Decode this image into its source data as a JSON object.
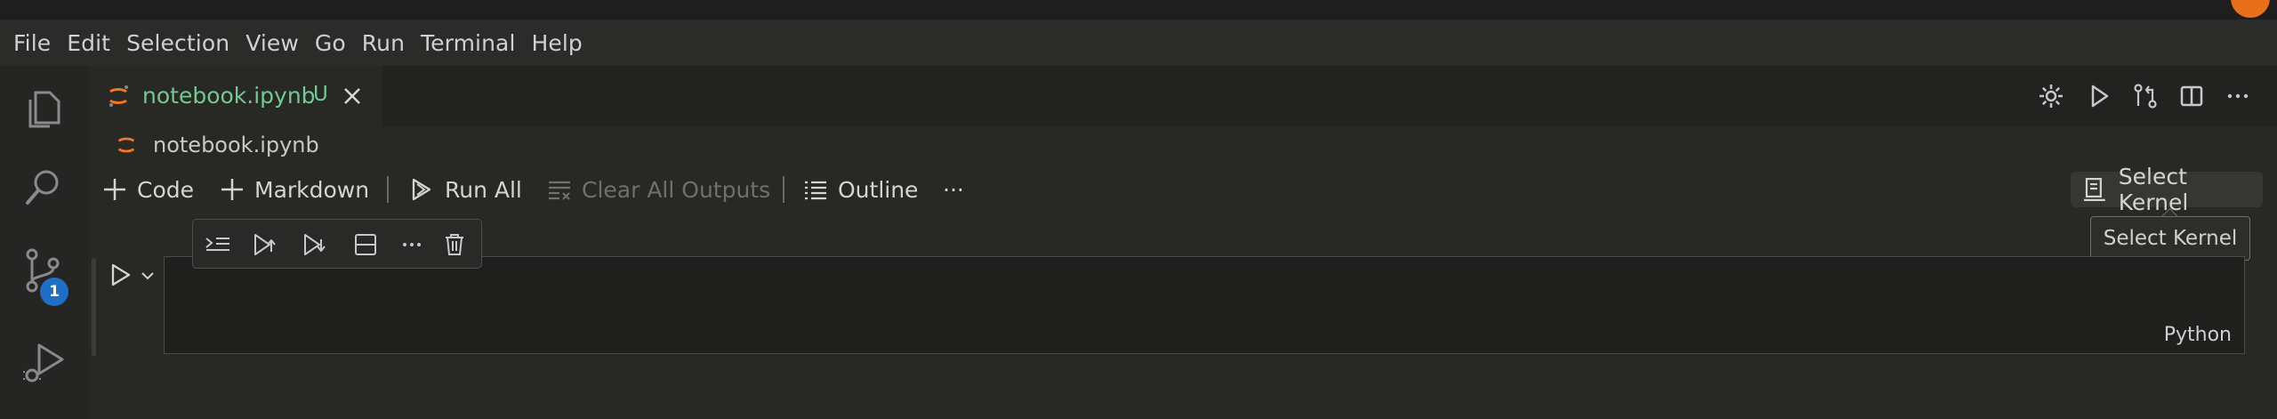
{
  "menu": [
    "File",
    "Edit",
    "Selection",
    "View",
    "Go",
    "Run",
    "Terminal",
    "Help"
  ],
  "activity": {
    "source_control_badge": "1"
  },
  "tab": {
    "label": "notebook.ipynb",
    "status": "U"
  },
  "breadcrumb": {
    "label": "notebook.ipynb"
  },
  "toolbar": {
    "code_label": "Code",
    "markdown_label": "Markdown",
    "run_all_label": "Run All",
    "clear_outputs_label": "Clear All Outputs",
    "outline_label": "Outline",
    "more_label": "···"
  },
  "kernel": {
    "button_label": "Select Kernel",
    "tooltip": "Select Kernel"
  },
  "cell": {
    "language": "Python"
  },
  "colors": {
    "accent_green": "#73c991",
    "jupyter_orange": "#f37626",
    "badge_blue": "#1f6fc5"
  }
}
